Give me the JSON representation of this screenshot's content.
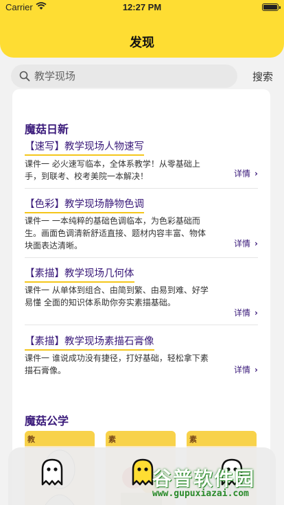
{
  "status_bar": {
    "carrier": "Carrier",
    "time": "12:27 PM"
  },
  "header": {
    "title": "发现"
  },
  "search": {
    "placeholder": "教学现场",
    "button_label": "搜索"
  },
  "section_daily": {
    "title": "魔菇日新",
    "items": [
      {
        "title": "【速写】教学现场人物速写",
        "desc": "课件一 必火速写临本，全体系教学！从零基础上手，到联考、校考美院一本解决！",
        "detail": "详情"
      },
      {
        "title": "【色彩】教学现场静物色调",
        "desc": "课件一 一本纯粹的基础色调临本，为色彩基础而生。画面色调清新舒适直接、题材内容丰富、物体块面表达清晰。",
        "detail": "详情"
      },
      {
        "title": "【素描】教学现场几何体",
        "desc": "课件一 从单体到组合、由简到繁、由易到难、好学易懂 全面的知识体系助你夯实素描基础。",
        "detail": "详情"
      },
      {
        "title": "【素描】教学现场素描石膏像",
        "desc": "课件一 谁说成功没有捷径，打好基础，轻松拿下素描石膏像。",
        "detail": "详情"
      }
    ]
  },
  "section_public": {
    "title": "魔菇公学",
    "thumbnails": [
      {
        "label": "教"
      },
      {
        "label": "素"
      },
      {
        "label": "素"
      }
    ]
  },
  "tabbar": {
    "icons": [
      "ghost-outline-icon",
      "ghost-filled-icon",
      "ghost-outline-icon"
    ]
  },
  "watermark": {
    "title": "谷普软件园",
    "url": "www.gupuxiazai.com"
  },
  "colors": {
    "header_yellow": "#fedd33",
    "accent_purple": "#3a1a7a",
    "underline_yellow": "#f4c61a"
  }
}
